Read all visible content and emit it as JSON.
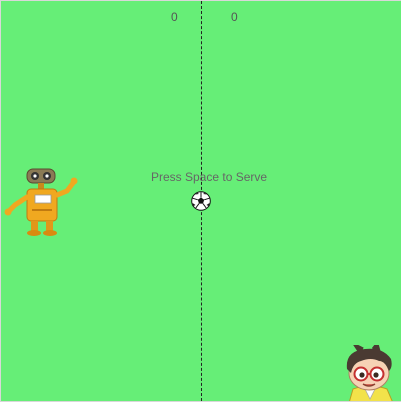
{
  "game": {
    "score_left": "0",
    "score_right": "0",
    "serve_prompt": "Press Space to Serve"
  },
  "colors": {
    "field": "#66ee77",
    "center_line": "#222222",
    "text": "#666666"
  },
  "sprites": {
    "left_player": "robot-sprite",
    "right_player": "boy-with-glasses-sprite",
    "ball": "soccer-ball"
  }
}
